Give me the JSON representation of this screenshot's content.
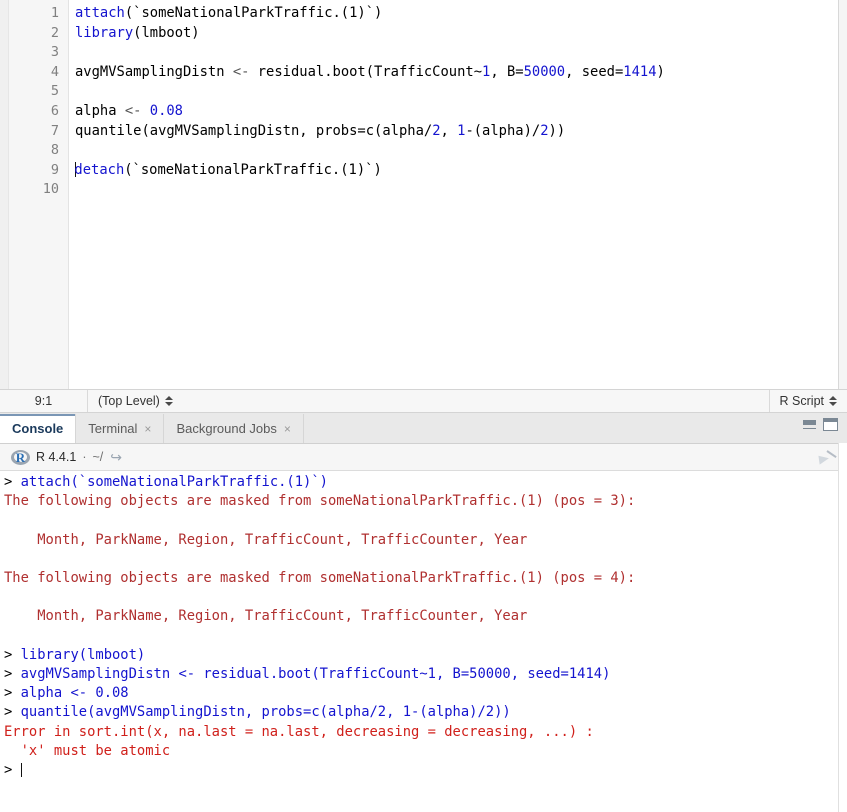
{
  "editor": {
    "lines": [
      {
        "num": "1",
        "tokens": [
          {
            "t": "fn",
            "s": "attach"
          },
          {
            "t": "plain",
            "s": "(`someNationalParkTraffic.(1)`)"
          }
        ]
      },
      {
        "num": "2",
        "tokens": [
          {
            "t": "fn",
            "s": "library"
          },
          {
            "t": "plain",
            "s": "(lmboot)"
          }
        ]
      },
      {
        "num": "3",
        "tokens": []
      },
      {
        "num": "4",
        "tokens": [
          {
            "t": "plain",
            "s": "avgMVSamplingDistn "
          },
          {
            "t": "op",
            "s": "<- "
          },
          {
            "t": "plain",
            "s": "residual.boot(TrafficCount~"
          },
          {
            "t": "num",
            "s": "1"
          },
          {
            "t": "plain",
            "s": ", B="
          },
          {
            "t": "num",
            "s": "50000"
          },
          {
            "t": "plain",
            "s": ", seed="
          },
          {
            "t": "num",
            "s": "1414"
          },
          {
            "t": "plain",
            "s": ")"
          }
        ]
      },
      {
        "num": "5",
        "tokens": []
      },
      {
        "num": "6",
        "tokens": [
          {
            "t": "plain",
            "s": "alpha "
          },
          {
            "t": "op",
            "s": "<- "
          },
          {
            "t": "num",
            "s": "0.08"
          }
        ]
      },
      {
        "num": "7",
        "tokens": [
          {
            "t": "plain",
            "s": "quantile(avgMVSamplingDistn, probs=c(alpha/"
          },
          {
            "t": "num",
            "s": "2"
          },
          {
            "t": "plain",
            "s": ", "
          },
          {
            "t": "num",
            "s": "1"
          },
          {
            "t": "plain",
            "s": "-(alpha)/"
          },
          {
            "t": "num",
            "s": "2"
          },
          {
            "t": "plain",
            "s": "))"
          }
        ]
      },
      {
        "num": "8",
        "tokens": []
      },
      {
        "num": "9",
        "caret": true,
        "tokens": [
          {
            "t": "fn",
            "s": "detach"
          },
          {
            "t": "plain",
            "s": "(`someNationalParkTraffic.(1)`)"
          }
        ]
      },
      {
        "num": "10",
        "tokens": []
      }
    ]
  },
  "status_bar": {
    "cursor_position": "9:1",
    "scope": "(Top Level)",
    "document_type": "R Script"
  },
  "console_tabs": [
    {
      "label": "Console",
      "active": true,
      "closable": false
    },
    {
      "label": "Terminal",
      "active": false,
      "closable": true,
      "close": "×"
    },
    {
      "label": "Background Jobs",
      "active": false,
      "closable": true,
      "close": "×"
    }
  ],
  "window_controls": {
    "minimize_title": "Minimize",
    "maximize_title": "Maximize"
  },
  "console_header": {
    "r_logo_letter": "R",
    "version": "R 4.4.1",
    "separator": "·",
    "working_directory": "~/",
    "path_arrow": "↪",
    "clear_title": "Clear Console"
  },
  "console_output": [
    {
      "cls": "con-prompt",
      "text": "> ",
      "cmd": "attach(`someNationalParkTraffic.(1)`)"
    },
    {
      "cls": "con-msg",
      "text": "The following objects are masked from someNationalParkTraffic.(1) (pos = 3):"
    },
    {
      "cls": "blank",
      "text": ""
    },
    {
      "cls": "con-msg",
      "text": "    Month, ParkName, Region, TrafficCount, TrafficCounter, Year"
    },
    {
      "cls": "blank",
      "text": ""
    },
    {
      "cls": "con-msg",
      "text": "The following objects are masked from someNationalParkTraffic.(1) (pos = 4):"
    },
    {
      "cls": "blank",
      "text": ""
    },
    {
      "cls": "con-msg",
      "text": "    Month, ParkName, Region, TrafficCount, TrafficCounter, Year"
    },
    {
      "cls": "blank",
      "text": ""
    },
    {
      "cls": "con-prompt",
      "text": "> ",
      "cmd": "library(lmboot)"
    },
    {
      "cls": "con-prompt",
      "text": "> ",
      "cmd": "avgMVSamplingDistn <- residual.boot(TrafficCount~1, B=50000, seed=1414)"
    },
    {
      "cls": "con-prompt",
      "text": "> ",
      "cmd": "alpha <- 0.08"
    },
    {
      "cls": "con-prompt",
      "text": "> ",
      "cmd": "quantile(avgMVSamplingDistn, probs=c(alpha/2, 1-(alpha)/2))"
    },
    {
      "cls": "con-err",
      "text": "Error in sort.int(x, na.last = na.last, decreasing = decreasing, ...) :"
    },
    {
      "cls": "con-err",
      "text": "  'x' must be atomic"
    },
    {
      "cls": "con-prompt-caret",
      "text": "> "
    }
  ],
  "colors": {
    "function_blue": "#1414cf",
    "number_blue": "#1414cf",
    "console_message_red": "#b03030",
    "console_error_red": "#d0201b",
    "active_tab_text": "#1b3a5c",
    "gutter_text": "#808080"
  }
}
